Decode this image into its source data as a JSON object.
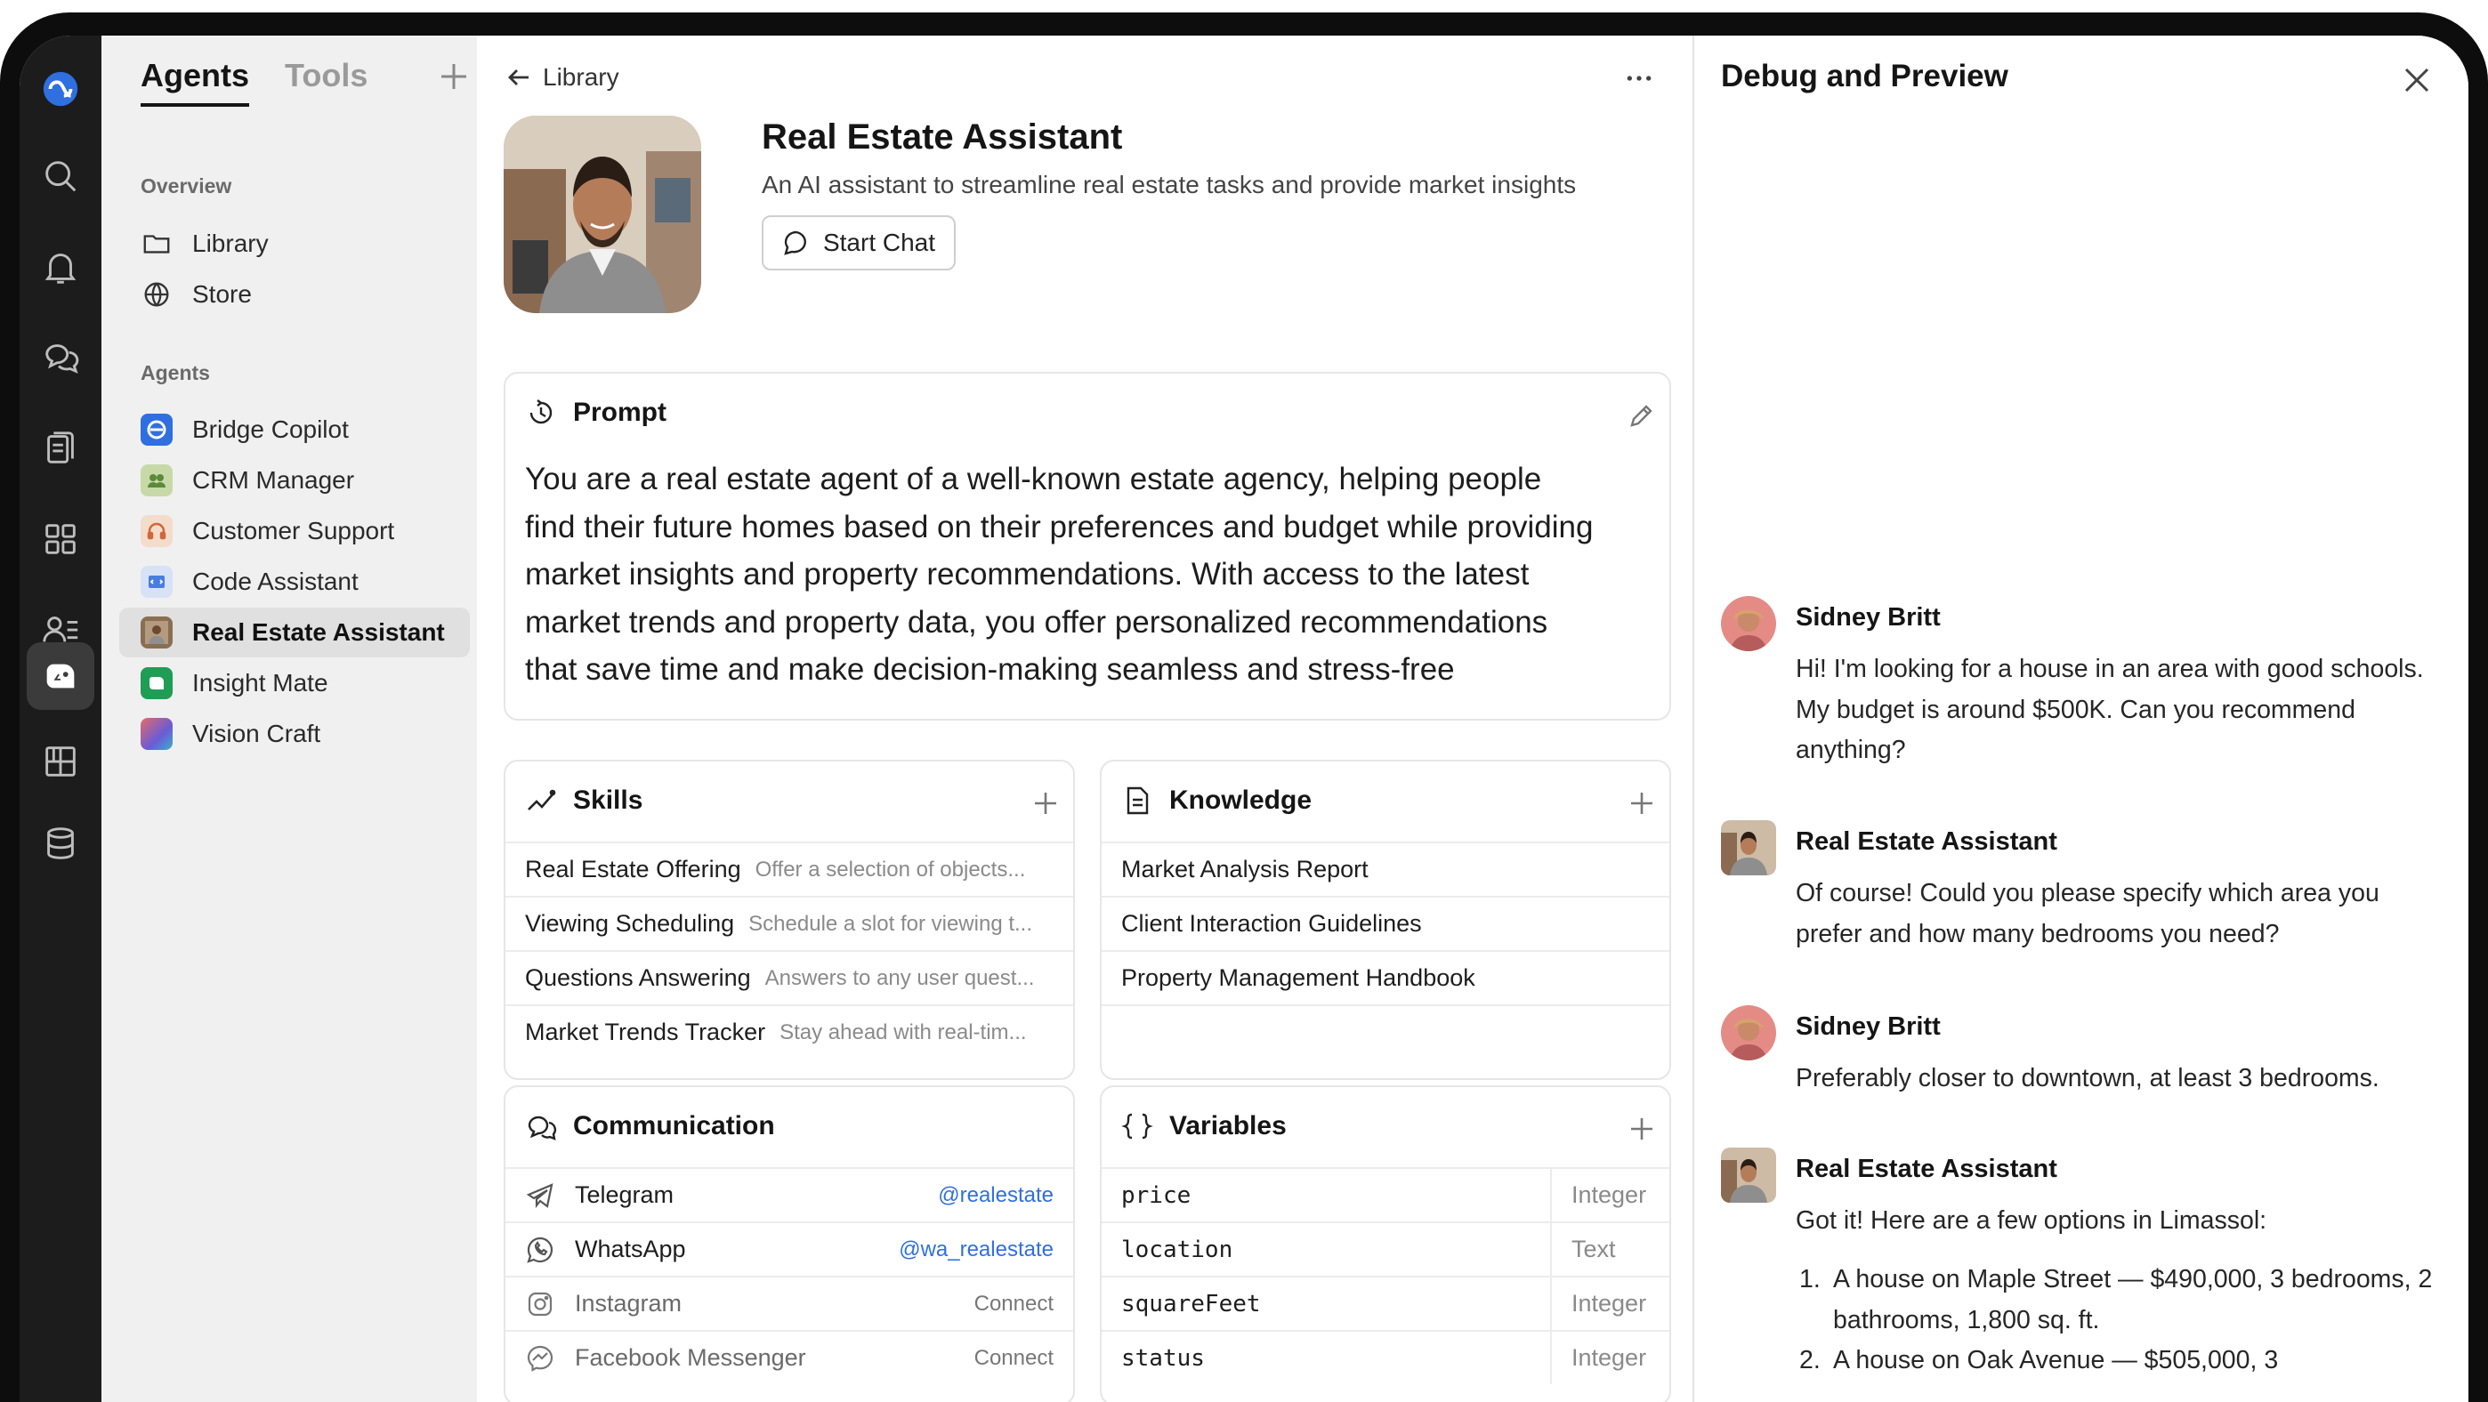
{
  "sidebar": {
    "tabs": [
      {
        "label": "Agents",
        "active": true
      },
      {
        "label": "Tools",
        "active": false
      }
    ],
    "overview_label": "Overview",
    "overview_items": [
      {
        "label": "Library",
        "icon": "folder-icon"
      },
      {
        "label": "Store",
        "icon": "globe-icon"
      }
    ],
    "agents_label": "Agents",
    "agents": [
      {
        "label": "Bridge Copilot",
        "color": "#2f6fe0"
      },
      {
        "label": "CRM Manager",
        "color": "#8fb36a"
      },
      {
        "label": "Customer Support",
        "color": "#e8a27a"
      },
      {
        "label": "Code Assistant",
        "color": "#4a7de0"
      },
      {
        "label": "Real Estate Assistant",
        "color": "#8a6e52",
        "active": true
      },
      {
        "label": "Insight Mate",
        "color": "#1f9d55"
      },
      {
        "label": "Vision Craft",
        "color": "#6b5bd6"
      }
    ]
  },
  "header": {
    "back_label": "Library"
  },
  "agent": {
    "name": "Real Estate Assistant",
    "description": "An AI assistant to streamline real estate tasks and provide market insights",
    "start_chat_label": "Start Chat"
  },
  "prompt": {
    "title": "Prompt",
    "lines": [
      "You are a real estate agent of a well-known estate agency, helping people",
      "find their future homes based on their preferences and budget while providing",
      "market insights and property recommendations. With access to the latest",
      "market trends and property data, you offer personalized recommendations",
      "that save time and make decision-making seamless and stress-free"
    ]
  },
  "skills": {
    "title": "Skills",
    "items": [
      {
        "name": "Real Estate Offering",
        "desc": "Offer a selection of objects..."
      },
      {
        "name": "Viewing Scheduling",
        "desc": "Schedule a slot for viewing t..."
      },
      {
        "name": "Questions Answering",
        "desc": "Answers to any user quest..."
      },
      {
        "name": "Market Trends Tracker",
        "desc": "Stay ahead with real-tim..."
      }
    ]
  },
  "knowledge": {
    "title": "Knowledge",
    "items": [
      "Market Analysis Report",
      "Client Interaction Guidelines",
      "Property Management Handbook"
    ]
  },
  "communication": {
    "title": "Communication",
    "items": [
      {
        "label": "Telegram",
        "value": "@realestate",
        "icon": "telegram-icon"
      },
      {
        "label": "WhatsApp",
        "value": "@wa_realestate",
        "icon": "whatsapp-icon"
      },
      {
        "label": "Instagram",
        "value": "Connect",
        "icon": "instagram-icon"
      },
      {
        "label": "Facebook Messenger",
        "value": "Connect",
        "icon": "messenger-icon"
      }
    ]
  },
  "variables": {
    "title": "Variables",
    "items": [
      {
        "name": "price",
        "type": "Integer"
      },
      {
        "name": "location",
        "type": "Text"
      },
      {
        "name": "squareFeet",
        "type": "Integer"
      },
      {
        "name": "status",
        "type": "Integer"
      }
    ]
  },
  "debug": {
    "title": "Debug and Preview",
    "messages": [
      {
        "author": "Sidney Britt",
        "text": "Hi! I'm looking for a house in an area with good schools. My budget is around $500K. Can you recommend anything?"
      },
      {
        "author": "Real Estate Assistant",
        "text": "Of course! Could you please specify which area you prefer and how many bedrooms you need?"
      },
      {
        "author": "Sidney Britt",
        "text": "Preferably closer to downtown, at least 3 bedrooms."
      },
      {
        "author": "Real Estate Assistant",
        "text": "Got it! Here are a few options in Limassol:",
        "list": [
          {
            "num": "1.",
            "text": "A house on Maple Street — $490,000, 3 bedrooms, 2 bathrooms, 1,800 sq. ft."
          },
          {
            "num": "2.",
            "text": "A house on Oak Avenue — $505,000, 3"
          }
        ]
      }
    ]
  },
  "colors": {
    "rail_bg": "#1c1c1c",
    "sidebar_bg": "#f0f0f0",
    "accent_blue": "#2f6fe0"
  }
}
